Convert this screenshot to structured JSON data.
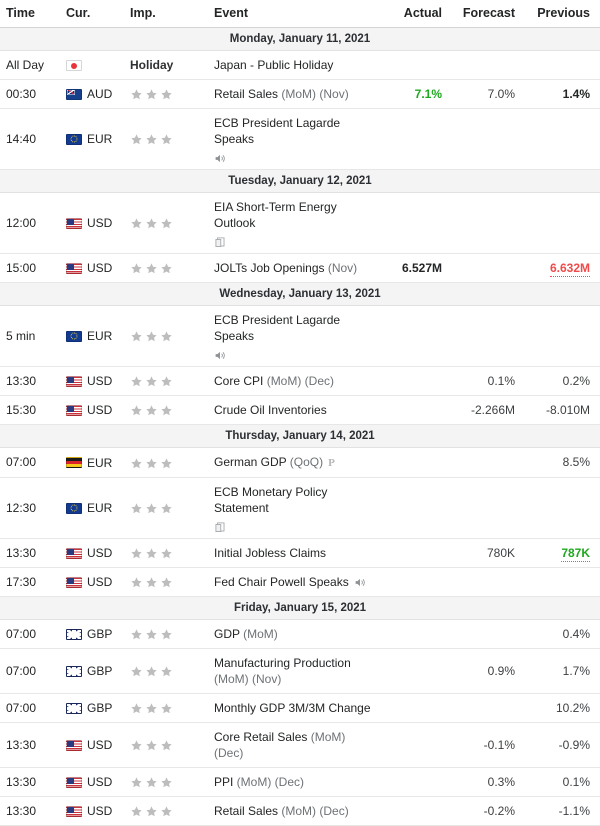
{
  "header": {
    "time": "Time",
    "currency": "Cur.",
    "importance": "Imp.",
    "event": "Event",
    "actual": "Actual",
    "forecast": "Forecast",
    "previous": "Previous"
  },
  "colors": {
    "positive": "#1fa81f",
    "negative": "#f04a4a",
    "star": "#bdbdbd",
    "day_header_bg": "#f4f4f4",
    "text": "#232526"
  },
  "days": [
    {
      "date_label": "Monday, January 11, 2021",
      "events": [
        {
          "time": "All Day",
          "currency": "",
          "flag": "jp",
          "flag_name": "japan-flag-icon",
          "importance_label": "Holiday",
          "stars": 0,
          "title": "Japan - Public Holiday",
          "sub": "",
          "icons": [],
          "actual": "",
          "actual_state": "none",
          "forecast": "",
          "previous": "",
          "previous_state": "none"
        },
        {
          "time": "00:30",
          "currency": "AUD",
          "flag": "au",
          "flag_name": "australia-flag-icon",
          "importance_label": "",
          "stars": 3,
          "title": "Retail Sales",
          "sub": " (MoM) (Nov)",
          "icons": [],
          "actual": "7.1%",
          "actual_state": "positive",
          "forecast": "7.0%",
          "previous": "1.4%",
          "previous_state": "bold"
        },
        {
          "time": "14:40",
          "currency": "EUR",
          "flag": "eu",
          "flag_name": "europe-flag-icon",
          "importance_label": "",
          "stars": 3,
          "title": "ECB President Lagarde Speaks",
          "sub": "",
          "icons": [
            "speaker-icon"
          ],
          "actual": "",
          "actual_state": "none",
          "forecast": "",
          "previous": "",
          "previous_state": "none"
        }
      ]
    },
    {
      "date_label": "Tuesday, January 12, 2021",
      "events": [
        {
          "time": "12:00",
          "currency": "USD",
          "flag": "us",
          "flag_name": "united-states-flag-icon",
          "importance_label": "",
          "stars": 3,
          "title": "EIA Short-Term Energy Outlook",
          "sub": "",
          "icons": [
            "document-icon"
          ],
          "actual": "",
          "actual_state": "none",
          "forecast": "",
          "previous": "",
          "previous_state": "none"
        },
        {
          "time": "15:00",
          "currency": "USD",
          "flag": "us",
          "flag_name": "united-states-flag-icon",
          "importance_label": "",
          "stars": 3,
          "title": "JOLTs Job Openings",
          "sub": " (Nov)",
          "icons": [],
          "actual": "6.527M",
          "actual_state": "bold",
          "forecast": "",
          "previous": "6.632M",
          "previous_state": "negative-underline"
        }
      ]
    },
    {
      "date_label": "Wednesday, January 13, 2021",
      "events": [
        {
          "time": "5 min",
          "currency": "EUR",
          "flag": "eu",
          "flag_name": "europe-flag-icon",
          "importance_label": "",
          "stars": 3,
          "title": "ECB President Lagarde Speaks",
          "sub": "",
          "icons": [
            "speaker-icon"
          ],
          "actual": "",
          "actual_state": "none",
          "forecast": "",
          "previous": "",
          "previous_state": "none"
        },
        {
          "time": "13:30",
          "currency": "USD",
          "flag": "us",
          "flag_name": "united-states-flag-icon",
          "importance_label": "",
          "stars": 3,
          "title": "Core CPI",
          "sub": " (MoM) (Dec)",
          "icons": [],
          "actual": "",
          "actual_state": "none",
          "forecast": "0.1%",
          "previous": "0.2%",
          "previous_state": "plain"
        },
        {
          "time": "15:30",
          "currency": "USD",
          "flag": "us",
          "flag_name": "united-states-flag-icon",
          "importance_label": "",
          "stars": 3,
          "title": "Crude Oil Inventories",
          "sub": "",
          "icons": [],
          "actual": "",
          "actual_state": "none",
          "forecast": "-2.266M",
          "previous": "-8.010M",
          "previous_state": "plain"
        }
      ]
    },
    {
      "date_label": "Thursday, January 14, 2021",
      "events": [
        {
          "time": "07:00",
          "currency": "EUR",
          "flag": "de",
          "flag_name": "germany-flag-icon",
          "importance_label": "",
          "stars": 3,
          "title": "German GDP",
          "sub": " (QoQ)",
          "icons": [
            "preliminary-icon"
          ],
          "actual": "",
          "actual_state": "none",
          "forecast": "",
          "previous": "8.5%",
          "previous_state": "plain"
        },
        {
          "time": "12:30",
          "currency": "EUR",
          "flag": "eu",
          "flag_name": "europe-flag-icon",
          "importance_label": "",
          "stars": 3,
          "title": "ECB Monetary Policy Statement",
          "sub": "",
          "icons": [
            "document-icon"
          ],
          "actual": "",
          "actual_state": "none",
          "forecast": "",
          "previous": "",
          "previous_state": "none"
        },
        {
          "time": "13:30",
          "currency": "USD",
          "flag": "us",
          "flag_name": "united-states-flag-icon",
          "importance_label": "",
          "stars": 3,
          "title": "Initial Jobless Claims",
          "sub": "",
          "icons": [],
          "actual": "",
          "actual_state": "none",
          "forecast": "780K",
          "previous": "787K",
          "previous_state": "positive-underline"
        },
        {
          "time": "17:30",
          "currency": "USD",
          "flag": "us",
          "flag_name": "united-states-flag-icon",
          "importance_label": "",
          "stars": 3,
          "title": "Fed Chair Powell Speaks",
          "sub": "",
          "icons": [
            "speaker-inline-icon"
          ],
          "actual": "",
          "actual_state": "none",
          "forecast": "",
          "previous": "",
          "previous_state": "none"
        }
      ]
    },
    {
      "date_label": "Friday, January 15, 2021",
      "events": [
        {
          "time": "07:00",
          "currency": "GBP",
          "flag": "gb",
          "flag_name": "united-kingdom-flag-icon",
          "importance_label": "",
          "stars": 3,
          "title": "GDP",
          "sub": " (MoM)",
          "icons": [],
          "actual": "",
          "actual_state": "none",
          "forecast": "",
          "previous": "0.4%",
          "previous_state": "plain"
        },
        {
          "time": "07:00",
          "currency": "GBP",
          "flag": "gb",
          "flag_name": "united-kingdom-flag-icon",
          "importance_label": "",
          "stars": 3,
          "title": "Manufacturing Production",
          "sub": " (MoM) (Nov)",
          "icons": [],
          "actual": "",
          "actual_state": "none",
          "forecast": "0.9%",
          "previous": "1.7%",
          "previous_state": "plain"
        },
        {
          "time": "07:00",
          "currency": "GBP",
          "flag": "gb",
          "flag_name": "united-kingdom-flag-icon",
          "importance_label": "",
          "stars": 3,
          "title": "Monthly GDP 3M/3M Change",
          "sub": "",
          "icons": [],
          "actual": "",
          "actual_state": "none",
          "forecast": "",
          "previous": "10.2%",
          "previous_state": "plain"
        },
        {
          "time": "13:30",
          "currency": "USD",
          "flag": "us",
          "flag_name": "united-states-flag-icon",
          "importance_label": "",
          "stars": 3,
          "title": "Core Retail Sales",
          "sub": " (MoM) (Dec)",
          "icons": [],
          "actual": "",
          "actual_state": "none",
          "forecast": "-0.1%",
          "previous": "-0.9%",
          "previous_state": "plain"
        },
        {
          "time": "13:30",
          "currency": "USD",
          "flag": "us",
          "flag_name": "united-states-flag-icon",
          "importance_label": "",
          "stars": 3,
          "title": "PPI",
          "sub": " (MoM) (Dec)",
          "icons": [],
          "actual": "",
          "actual_state": "none",
          "forecast": "0.3%",
          "previous": "0.1%",
          "previous_state": "plain"
        },
        {
          "time": "13:30",
          "currency": "USD",
          "flag": "us",
          "flag_name": "united-states-flag-icon",
          "importance_label": "",
          "stars": 3,
          "title": "Retail Sales",
          "sub": " (MoM) (Dec)",
          "icons": [],
          "actual": "",
          "actual_state": "none",
          "forecast": "-0.2%",
          "previous": "-1.1%",
          "previous_state": "plain"
        }
      ]
    }
  ]
}
